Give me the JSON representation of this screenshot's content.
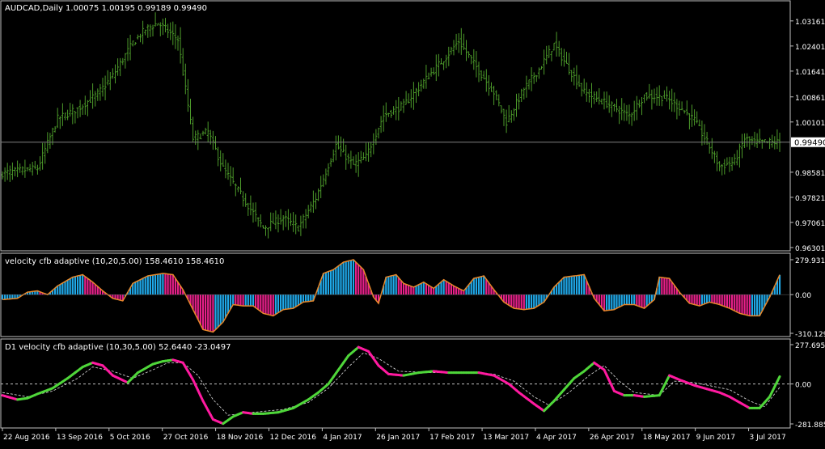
{
  "colors": {
    "background": "#000000",
    "frame": "#c0c0c0",
    "bar": "#4c9a2a",
    "bid_line": "#808080",
    "hist_up": "#1fa8e8",
    "hist_down": "#e8208a",
    "osc_line": "#e8882a",
    "d1_up": "#4fd63a",
    "d1_down": "#ff1aa0",
    "signal": "#e0e0e0",
    "text": "#ffffff"
  },
  "chart_data": [
    {
      "type": "ohlc",
      "title": "AUDCAD,Daily  1.00075 1.00195 0.99189 0.99490",
      "current_price": 0.9949,
      "current_price_label": "0.99490",
      "ylim": [
        0.963,
        1.035
      ],
      "y_ticks": [
        1.03161,
        1.02401,
        1.01641,
        1.00861,
        1.00101,
        0.98581,
        0.97821,
        0.97061,
        0.96301
      ],
      "y_tick_labels": [
        "1.03161",
        "1.02401",
        "1.01641",
        "1.00861",
        "1.00101",
        "0.98581",
        "0.97821",
        "0.97061",
        "0.96301"
      ],
      "x_tick_labels": [
        "22 Aug 2016",
        "13 Sep 2016",
        "5 Oct 2016",
        "27 Oct 2016",
        "18 Nov 2016",
        "12 Dec 2016",
        "4 Jan 2017",
        "26 Jan 2017",
        "17 Feb 2017",
        "13 Mar 2017",
        "4 Apr 2017",
        "26 Apr 2017",
        "18 May 2017",
        "9 Jun 2017",
        "3 Jul 2017"
      ],
      "close_path": [
        [
          0,
          0.9855
        ],
        [
          14,
          0.987
        ],
        [
          22,
          1.002
        ],
        [
          30,
          1.005
        ],
        [
          38,
          1.0095
        ],
        [
          44,
          1.015
        ],
        [
          52,
          1.025
        ],
        [
          57,
          1.029
        ],
        [
          62,
          1.031
        ],
        [
          70,
          1.026
        ],
        [
          76,
          0.996
        ],
        [
          82,
          0.998
        ],
        [
          88,
          0.987
        ],
        [
          96,
          0.978
        ],
        [
          104,
          0.969
        ],
        [
          112,
          0.972
        ],
        [
          118,
          0.969
        ],
        [
          125,
          0.978
        ],
        [
          133,
          0.994
        ],
        [
          140,
          0.988
        ],
        [
          145,
          0.9905
        ],
        [
          152,
          1.003
        ],
        [
          160,
          1.006
        ],
        [
          170,
          1.015
        ],
        [
          176,
          1.02
        ],
        [
          182,
          1.0255
        ],
        [
          190,
          1.0165
        ],
        [
          196,
          1.01
        ],
        [
          201,
          1.001
        ],
        [
          208,
          1.011
        ],
        [
          214,
          1.017
        ],
        [
          220,
          1.0245
        ],
        [
          226,
          1.017
        ],
        [
          232,
          1.01
        ],
        [
          240,
          1.007
        ],
        [
          250,
          1.003
        ],
        [
          256,
          1.009
        ],
        [
          264,
          1.0085
        ],
        [
          271,
          1.005
        ],
        [
          276,
          1.0015
        ],
        [
          282,
          0.9935
        ],
        [
          286,
          0.9875
        ],
        [
          292,
          0.989
        ],
        [
          296,
          0.996
        ],
        [
          300,
          0.9949
        ]
      ]
    },
    {
      "type": "histogram",
      "title": "velocity cfb adaptive (10,20,5.00) 158.4610 158.4610",
      "ylim": [
        -310.1293,
        279.9316
      ],
      "y_ticks": [
        279.9316,
        0.0,
        -310.1293
      ],
      "y_tick_labels": [
        "279.9316",
        "0.00",
        "-310.1293"
      ],
      "values_path": [
        [
          0,
          -40
        ],
        [
          6,
          -30
        ],
        [
          10,
          20
        ],
        [
          14,
          30
        ],
        [
          18,
          0
        ],
        [
          22,
          70
        ],
        [
          28,
          140
        ],
        [
          32,
          160
        ],
        [
          36,
          100
        ],
        [
          40,
          30
        ],
        [
          44,
          -30
        ],
        [
          48,
          -50
        ],
        [
          52,
          90
        ],
        [
          58,
          150
        ],
        [
          64,
          170
        ],
        [
          68,
          160
        ],
        [
          72,
          40
        ],
        [
          76,
          -120
        ],
        [
          80,
          -280
        ],
        [
          84,
          -300
        ],
        [
          88,
          -220
        ],
        [
          92,
          -80
        ],
        [
          96,
          -90
        ],
        [
          100,
          -90
        ],
        [
          104,
          -150
        ],
        [
          108,
          -170
        ],
        [
          112,
          -120
        ],
        [
          116,
          -110
        ],
        [
          120,
          -60
        ],
        [
          124,
          -50
        ],
        [
          128,
          170
        ],
        [
          132,
          200
        ],
        [
          136,
          260
        ],
        [
          140,
          280
        ],
        [
          144,
          200
        ],
        [
          148,
          -20
        ],
        [
          150,
          -70
        ],
        [
          153,
          140
        ],
        [
          157,
          160
        ],
        [
          160,
          90
        ],
        [
          164,
          60
        ],
        [
          168,
          100
        ],
        [
          172,
          50
        ],
        [
          176,
          120
        ],
        [
          180,
          70
        ],
        [
          184,
          30
        ],
        [
          188,
          130
        ],
        [
          192,
          150
        ],
        [
          196,
          40
        ],
        [
          200,
          -60
        ],
        [
          204,
          -110
        ],
        [
          208,
          -120
        ],
        [
          212,
          -110
        ],
        [
          216,
          -60
        ],
        [
          220,
          60
        ],
        [
          224,
          140
        ],
        [
          228,
          150
        ],
        [
          232,
          160
        ],
        [
          236,
          -30
        ],
        [
          240,
          -130
        ],
        [
          244,
          -120
        ],
        [
          248,
          -80
        ],
        [
          252,
          -80
        ],
        [
          256,
          -110
        ],
        [
          260,
          -40
        ],
        [
          262,
          140
        ],
        [
          266,
          130
        ],
        [
          270,
          20
        ],
        [
          274,
          -70
        ],
        [
          278,
          -90
        ],
        [
          282,
          -60
        ],
        [
          286,
          -80
        ],
        [
          290,
          -110
        ],
        [
          294,
          -150
        ],
        [
          298,
          -170
        ],
        [
          302,
          -170
        ],
        [
          306,
          -20
        ],
        [
          310,
          158.461
        ]
      ]
    },
    {
      "type": "line",
      "title": "D1 velocity cfb adaptive (10,30,5.00) 52.6440 -23.0497",
      "ylim": [
        -281.8853,
        277.6953
      ],
      "y_ticks": [
        277.6953,
        0.0,
        -281.8853
      ],
      "y_tick_labels": [
        "277.6953",
        "0.00",
        "-281.8853"
      ],
      "series_path": [
        [
          0,
          -80
        ],
        [
          6,
          -110
        ],
        [
          10,
          -100
        ],
        [
          14,
          -70
        ],
        [
          20,
          -30
        ],
        [
          26,
          40
        ],
        [
          32,
          120
        ],
        [
          36,
          150
        ],
        [
          40,
          130
        ],
        [
          44,
          60
        ],
        [
          50,
          10
        ],
        [
          54,
          80
        ],
        [
          60,
          140
        ],
        [
          64,
          160
        ],
        [
          68,
          170
        ],
        [
          72,
          150
        ],
        [
          76,
          30
        ],
        [
          80,
          -120
        ],
        [
          84,
          -250
        ],
        [
          88,
          -280
        ],
        [
          92,
          -230
        ],
        [
          96,
          -200
        ],
        [
          100,
          -210
        ],
        [
          104,
          -210
        ],
        [
          110,
          -200
        ],
        [
          116,
          -170
        ],
        [
          122,
          -110
        ],
        [
          126,
          -60
        ],
        [
          130,
          0
        ],
        [
          134,
          100
        ],
        [
          138,
          200
        ],
        [
          142,
          260
        ],
        [
          146,
          230
        ],
        [
          150,
          130
        ],
        [
          154,
          70
        ],
        [
          160,
          60
        ],
        [
          166,
          80
        ],
        [
          172,
          90
        ],
        [
          178,
          80
        ],
        [
          184,
          80
        ],
        [
          190,
          80
        ],
        [
          196,
          60
        ],
        [
          202,
          0
        ],
        [
          206,
          -60
        ],
        [
          212,
          -140
        ],
        [
          216,
          -190
        ],
        [
          220,
          -120
        ],
        [
          224,
          -40
        ],
        [
          228,
          40
        ],
        [
          232,
          90
        ],
        [
          236,
          150
        ],
        [
          240,
          100
        ],
        [
          244,
          -50
        ],
        [
          248,
          -80
        ],
        [
          252,
          -80
        ],
        [
          256,
          -90
        ],
        [
          262,
          -80
        ],
        [
          266,
          60
        ],
        [
          270,
          30
        ],
        [
          276,
          -10
        ],
        [
          280,
          -30
        ],
        [
          286,
          -60
        ],
        [
          290,
          -90
        ],
        [
          294,
          -130
        ],
        [
          298,
          -170
        ],
        [
          302,
          -170
        ],
        [
          306,
          -90
        ],
        [
          310,
          52.644
        ]
      ],
      "signal_path": [
        [
          0,
          -60
        ],
        [
          10,
          -90
        ],
        [
          20,
          -50
        ],
        [
          30,
          40
        ],
        [
          36,
          120
        ],
        [
          44,
          90
        ],
        [
          52,
          40
        ],
        [
          60,
          100
        ],
        [
          66,
          150
        ],
        [
          72,
          150
        ],
        [
          78,
          60
        ],
        [
          84,
          -110
        ],
        [
          90,
          -220
        ],
        [
          100,
          -200
        ],
        [
          112,
          -180
        ],
        [
          122,
          -130
        ],
        [
          130,
          -30
        ],
        [
          138,
          120
        ],
        [
          144,
          220
        ],
        [
          150,
          180
        ],
        [
          158,
          90
        ],
        [
          170,
          80
        ],
        [
          184,
          80
        ],
        [
          196,
          70
        ],
        [
          204,
          20
        ],
        [
          212,
          -90
        ],
        [
          218,
          -150
        ],
        [
          226,
          -60
        ],
        [
          234,
          60
        ],
        [
          240,
          130
        ],
        [
          246,
          20
        ],
        [
          252,
          -60
        ],
        [
          262,
          -80
        ],
        [
          268,
          20
        ],
        [
          276,
          10
        ],
        [
          290,
          -40
        ],
        [
          298,
          -120
        ],
        [
          304,
          -160
        ],
        [
          310,
          -23.0497
        ]
      ]
    }
  ]
}
